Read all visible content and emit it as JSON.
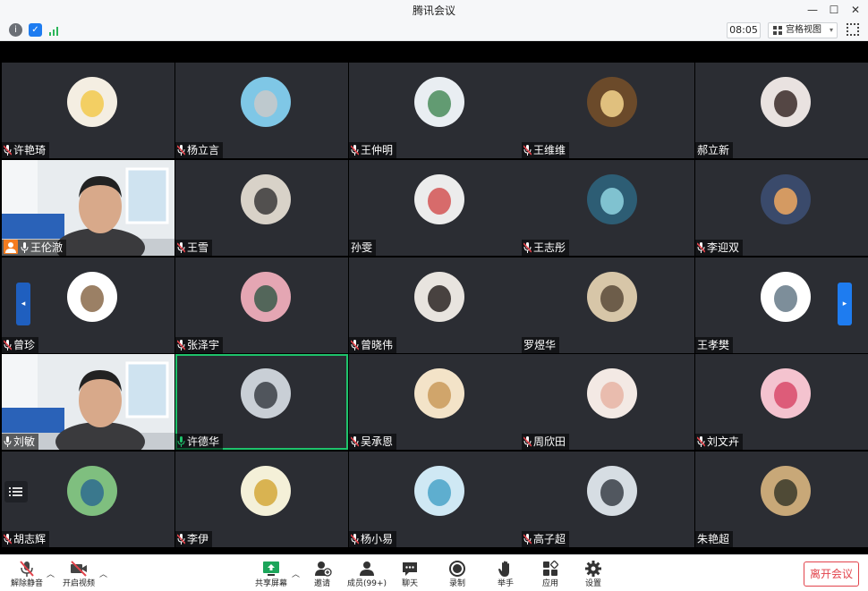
{
  "window": {
    "title": "腾讯会议",
    "minimize": "—",
    "maximize": "☐",
    "close": "✕"
  },
  "toolbar": {
    "time": "08:05",
    "view_label": "宫格视图",
    "view_caret": "▾"
  },
  "tiles": [
    {
      "name": "许艳琦",
      "muted": true
    },
    {
      "name": "杨立言",
      "muted": true
    },
    {
      "name": "王仲明",
      "muted": true
    },
    {
      "name": "王维维",
      "muted": true
    },
    {
      "name": "郝立新",
      "muted": false
    },
    {
      "name": "王伦澈",
      "muted": false,
      "video": true,
      "host": true
    },
    {
      "name": "王雪",
      "muted": true
    },
    {
      "name": "孙雯",
      "muted": false
    },
    {
      "name": "王志彤",
      "muted": true
    },
    {
      "name": "李迎双",
      "muted": true
    },
    {
      "name": "曾珍",
      "muted": true
    },
    {
      "name": "张泽宇",
      "muted": true
    },
    {
      "name": "曾晓伟",
      "muted": true
    },
    {
      "name": "罗煜华",
      "muted": false
    },
    {
      "name": "王孝樊",
      "muted": false
    },
    {
      "name": "刘敏",
      "muted": false,
      "video": true
    },
    {
      "name": "许德华",
      "muted": false,
      "speaking": true
    },
    {
      "name": "吴承恩",
      "muted": true
    },
    {
      "name": "周欣田",
      "muted": true
    },
    {
      "name": "刘文卉",
      "muted": true
    },
    {
      "name": "胡志辉",
      "muted": true
    },
    {
      "name": "李伊",
      "muted": true
    },
    {
      "name": "杨小易",
      "muted": true
    },
    {
      "name": "高子超",
      "muted": true
    },
    {
      "name": "朱艳超",
      "muted": false
    }
  ],
  "bottom": {
    "unmute": "解除静音",
    "video": "开启视频",
    "share": "共享屏幕",
    "invite": "邀请",
    "members": "成员(99+)",
    "chat": "聊天",
    "record": "录制",
    "hand": "举手",
    "apps": "应用",
    "settings": "设置",
    "leave": "离开会议"
  },
  "colors": {
    "accent": "#1e7cf0",
    "speaking": "#1ec26b",
    "leave": "#e2434b",
    "host": "#f57c1f"
  }
}
